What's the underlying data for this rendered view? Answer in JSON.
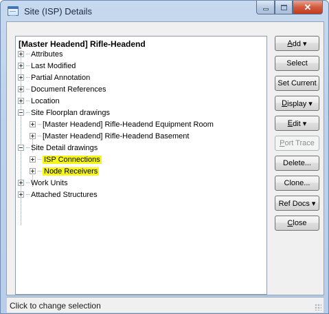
{
  "window": {
    "title": "Site (ISP) Details"
  },
  "tree": {
    "root": "[Master Headend] Rifle-Headend",
    "items": [
      {
        "label": "Attributes",
        "expanded": false
      },
      {
        "label": "Last Modified",
        "expanded": false
      },
      {
        "label": "Partial Annotation",
        "expanded": false
      },
      {
        "label": "Document References",
        "expanded": false
      },
      {
        "label": "Location",
        "expanded": false
      },
      {
        "label": "Site Floorplan drawings",
        "expanded": true,
        "children": [
          {
            "label": "[Master Headend] Rifle-Headend Equipment Room",
            "expanded": false
          },
          {
            "label": "[Master Headend] Rifle-Headend Basement",
            "expanded": false
          }
        ]
      },
      {
        "label": "Site Detail drawings",
        "expanded": true,
        "children": [
          {
            "label": "ISP Connections",
            "expanded": false,
            "highlighted": true
          },
          {
            "label": "Node Receivers",
            "expanded": false,
            "highlighted": true
          }
        ]
      },
      {
        "label": "Work Units",
        "expanded": false
      },
      {
        "label": "Attached Structures",
        "expanded": false
      }
    ],
    "highlight_color": "#f5f516"
  },
  "buttons": {
    "add": {
      "mnemonic": "A",
      "rest": "dd ▾"
    },
    "select": "Select",
    "set_current": "Set Current",
    "display": {
      "mnemonic": "D",
      "rest": "isplay ▾"
    },
    "edit": {
      "mnemonic": "E",
      "rest": "dit ▾"
    },
    "port_trace": {
      "mnemonic": "P",
      "rest": "ort Trace",
      "enabled": false
    },
    "delete": "Delete...",
    "clone": "Clone...",
    "ref_docs": "Ref Docs ▾",
    "close": {
      "mnemonic": "C",
      "rest": "lose"
    }
  },
  "status": {
    "text": "Click to change selection"
  }
}
